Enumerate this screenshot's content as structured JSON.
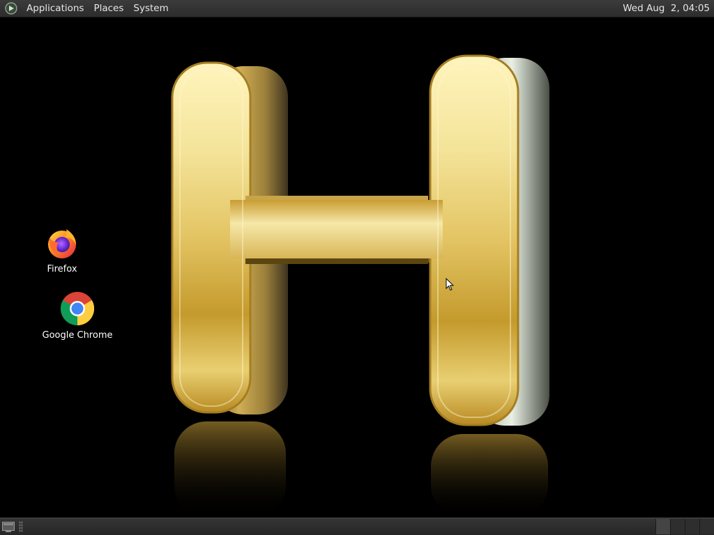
{
  "top_panel": {
    "menus": {
      "applications": "Applications",
      "places": "Places",
      "system": "System"
    },
    "clock": "Wed Aug  2, 04:05"
  },
  "desktop": {
    "icons": [
      {
        "label": "Firefox",
        "icon": "firefox-icon"
      },
      {
        "label": "Google Chrome",
        "icon": "chrome-icon"
      }
    ],
    "wallpaper": "gold-letter-H-on-black"
  },
  "bottom_panel": {
    "workspaces_count": 4,
    "active_workspace": 1
  },
  "colors": {
    "panel": "#2e2e2e",
    "wallpaper_bg": "#000000",
    "gold": "#f2dc7a"
  }
}
